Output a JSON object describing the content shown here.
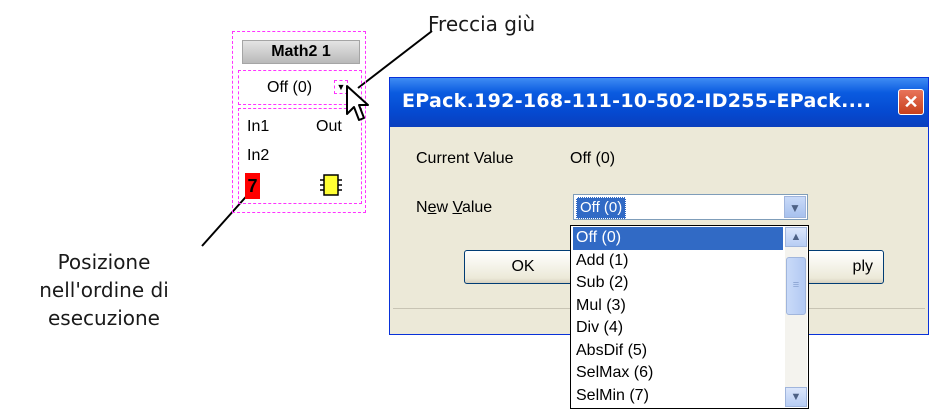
{
  "callouts": {
    "arrow_label": "Freccia giù",
    "exec_order_label": [
      "Posizione",
      "nell'ordine di",
      "esecuzione"
    ]
  },
  "block": {
    "title": "Math2 1",
    "value": "Off (0)",
    "in1": "In1",
    "in2": "In2",
    "out": "Out",
    "order": "7",
    "icons": [
      "down-arrow-icon",
      "mouse-pointer-icon",
      "chip-icon"
    ]
  },
  "dialog": {
    "title": "EPack.192-168-111-10-502-ID255-EPack....",
    "close_glyph": "✕",
    "current_value_label": "Current Value",
    "current_value": "Off (0)",
    "new_value_label": "New Value",
    "new_value": "Off (0)",
    "ok_label": "OK",
    "apply_label": "ply"
  },
  "dropdown": {
    "options": [
      "Off (0)",
      "Add (1)",
      "Sub (2)",
      "Mul (3)",
      "Div (4)",
      "AbsDif (5)",
      "SelMax (6)",
      "SelMin (7)"
    ],
    "selected_index": 0
  },
  "colors": {
    "dash": "#ff33ff",
    "titlebar": "#0a5be0",
    "selection": "#316ac5",
    "order_badge": "#ff0000",
    "dialog_bg": "#ece9d8"
  }
}
